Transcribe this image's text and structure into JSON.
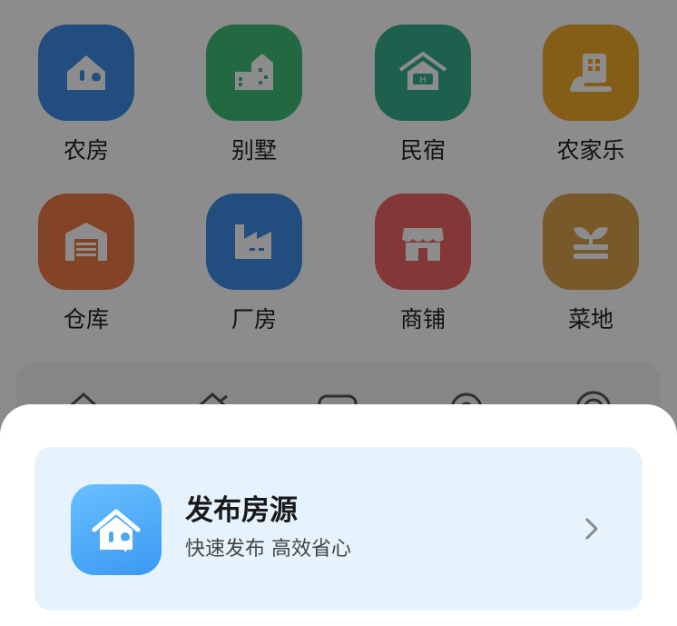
{
  "categories": [
    {
      "label": "农房",
      "icon": "farmhouse-icon",
      "color": "#3d8ee6"
    },
    {
      "label": "别墅",
      "icon": "villa-icon",
      "color": "#3fbf77"
    },
    {
      "label": "民宿",
      "icon": "homestay-icon",
      "color": "#35b08f"
    },
    {
      "label": "农家乐",
      "icon": "agritainment-icon",
      "color": "#f0a928"
    },
    {
      "label": "仓库",
      "icon": "warehouse-icon",
      "color": "#ee7a45"
    },
    {
      "label": "厂房",
      "icon": "factory-icon",
      "color": "#3d8ee6"
    },
    {
      "label": "商铺",
      "icon": "shop-icon",
      "color": "#f06464"
    },
    {
      "label": "菜地",
      "icon": "vegetable-plot-icon",
      "color": "#d9a24e"
    }
  ],
  "publish_card": {
    "title": "发布房源",
    "subtitle": "快速发布 高效省心",
    "icon": "house-tree-icon",
    "accent": "#4aa8f5",
    "background": "#e6f3fd"
  },
  "colors": {
    "overlay": "rgba(0,0,0,0.45)",
    "sheet": "#ffffff"
  }
}
